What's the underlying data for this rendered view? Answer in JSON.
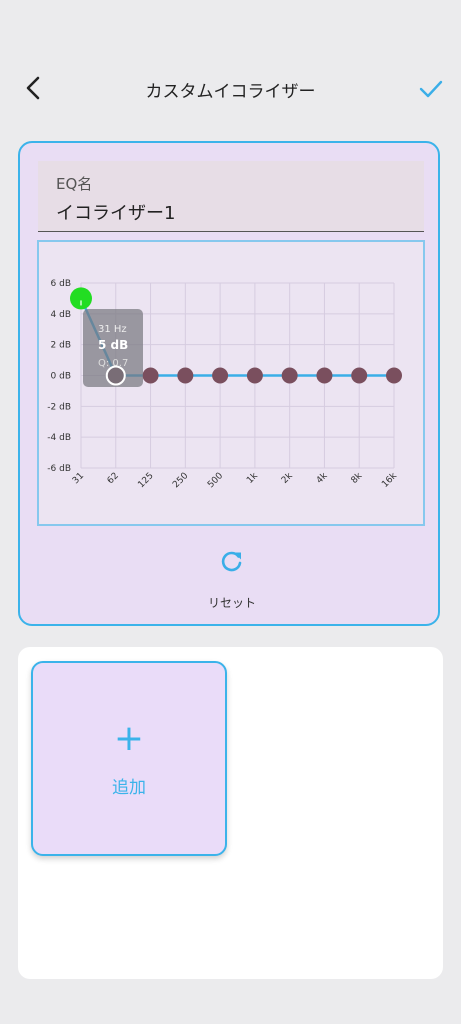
{
  "header": {
    "title": "カスタムイコライザー"
  },
  "eq": {
    "name_label": "EQ名",
    "name_value": "イコライザー1"
  },
  "chart_data": {
    "type": "line",
    "xlabel": "",
    "ylabel": "",
    "ylim": [
      -6,
      6
    ],
    "y_ticks": [
      "6 dB",
      "4 dB",
      "2 dB",
      "0 dB",
      "-2 dB",
      "-4 dB",
      "-6 dB"
    ],
    "categories": [
      "31",
      "62",
      "125",
      "250",
      "500",
      "1k",
      "2k",
      "4k",
      "8k",
      "16k"
    ],
    "values": [
      5,
      0,
      0,
      0,
      0,
      0,
      0,
      0,
      0,
      0
    ],
    "colors": {
      "line": "#3aaee8",
      "point": "#7a4f5e",
      "selected_point": "#22dd22"
    },
    "tooltip": {
      "freq": "31 Hz",
      "gain": "5 dB",
      "q": "Q: 0.7"
    }
  },
  "reset": {
    "label": "リセット"
  },
  "presets": {
    "add_label": "追加",
    "add_symbol": "+"
  }
}
